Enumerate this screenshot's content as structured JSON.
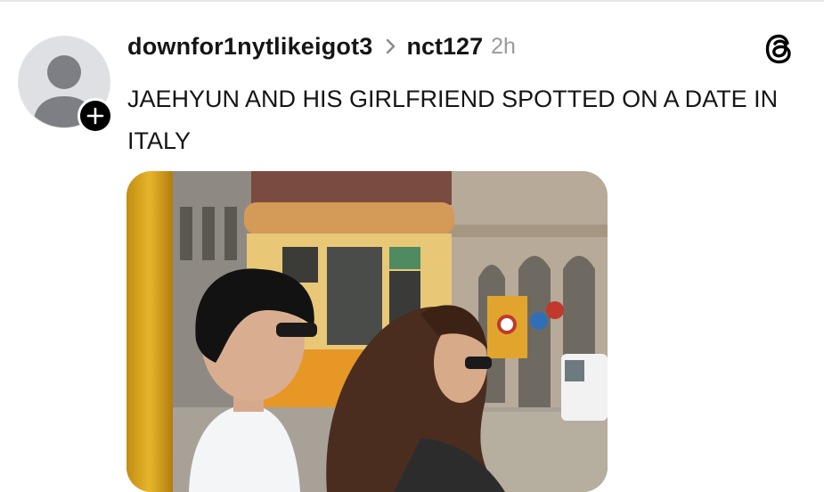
{
  "post": {
    "username": "downfor1nytlikeigot3",
    "community": "nct127",
    "timestamp": "2h",
    "text": "JAEHYUN AND HIS GIRLFRIEND SPOTTED ON A DATE IN ITALY"
  },
  "icons": {
    "avatar": "default-user-avatar",
    "follow": "plus-icon",
    "separator": "chevron-right-icon",
    "app": "threads-logo-icon"
  }
}
